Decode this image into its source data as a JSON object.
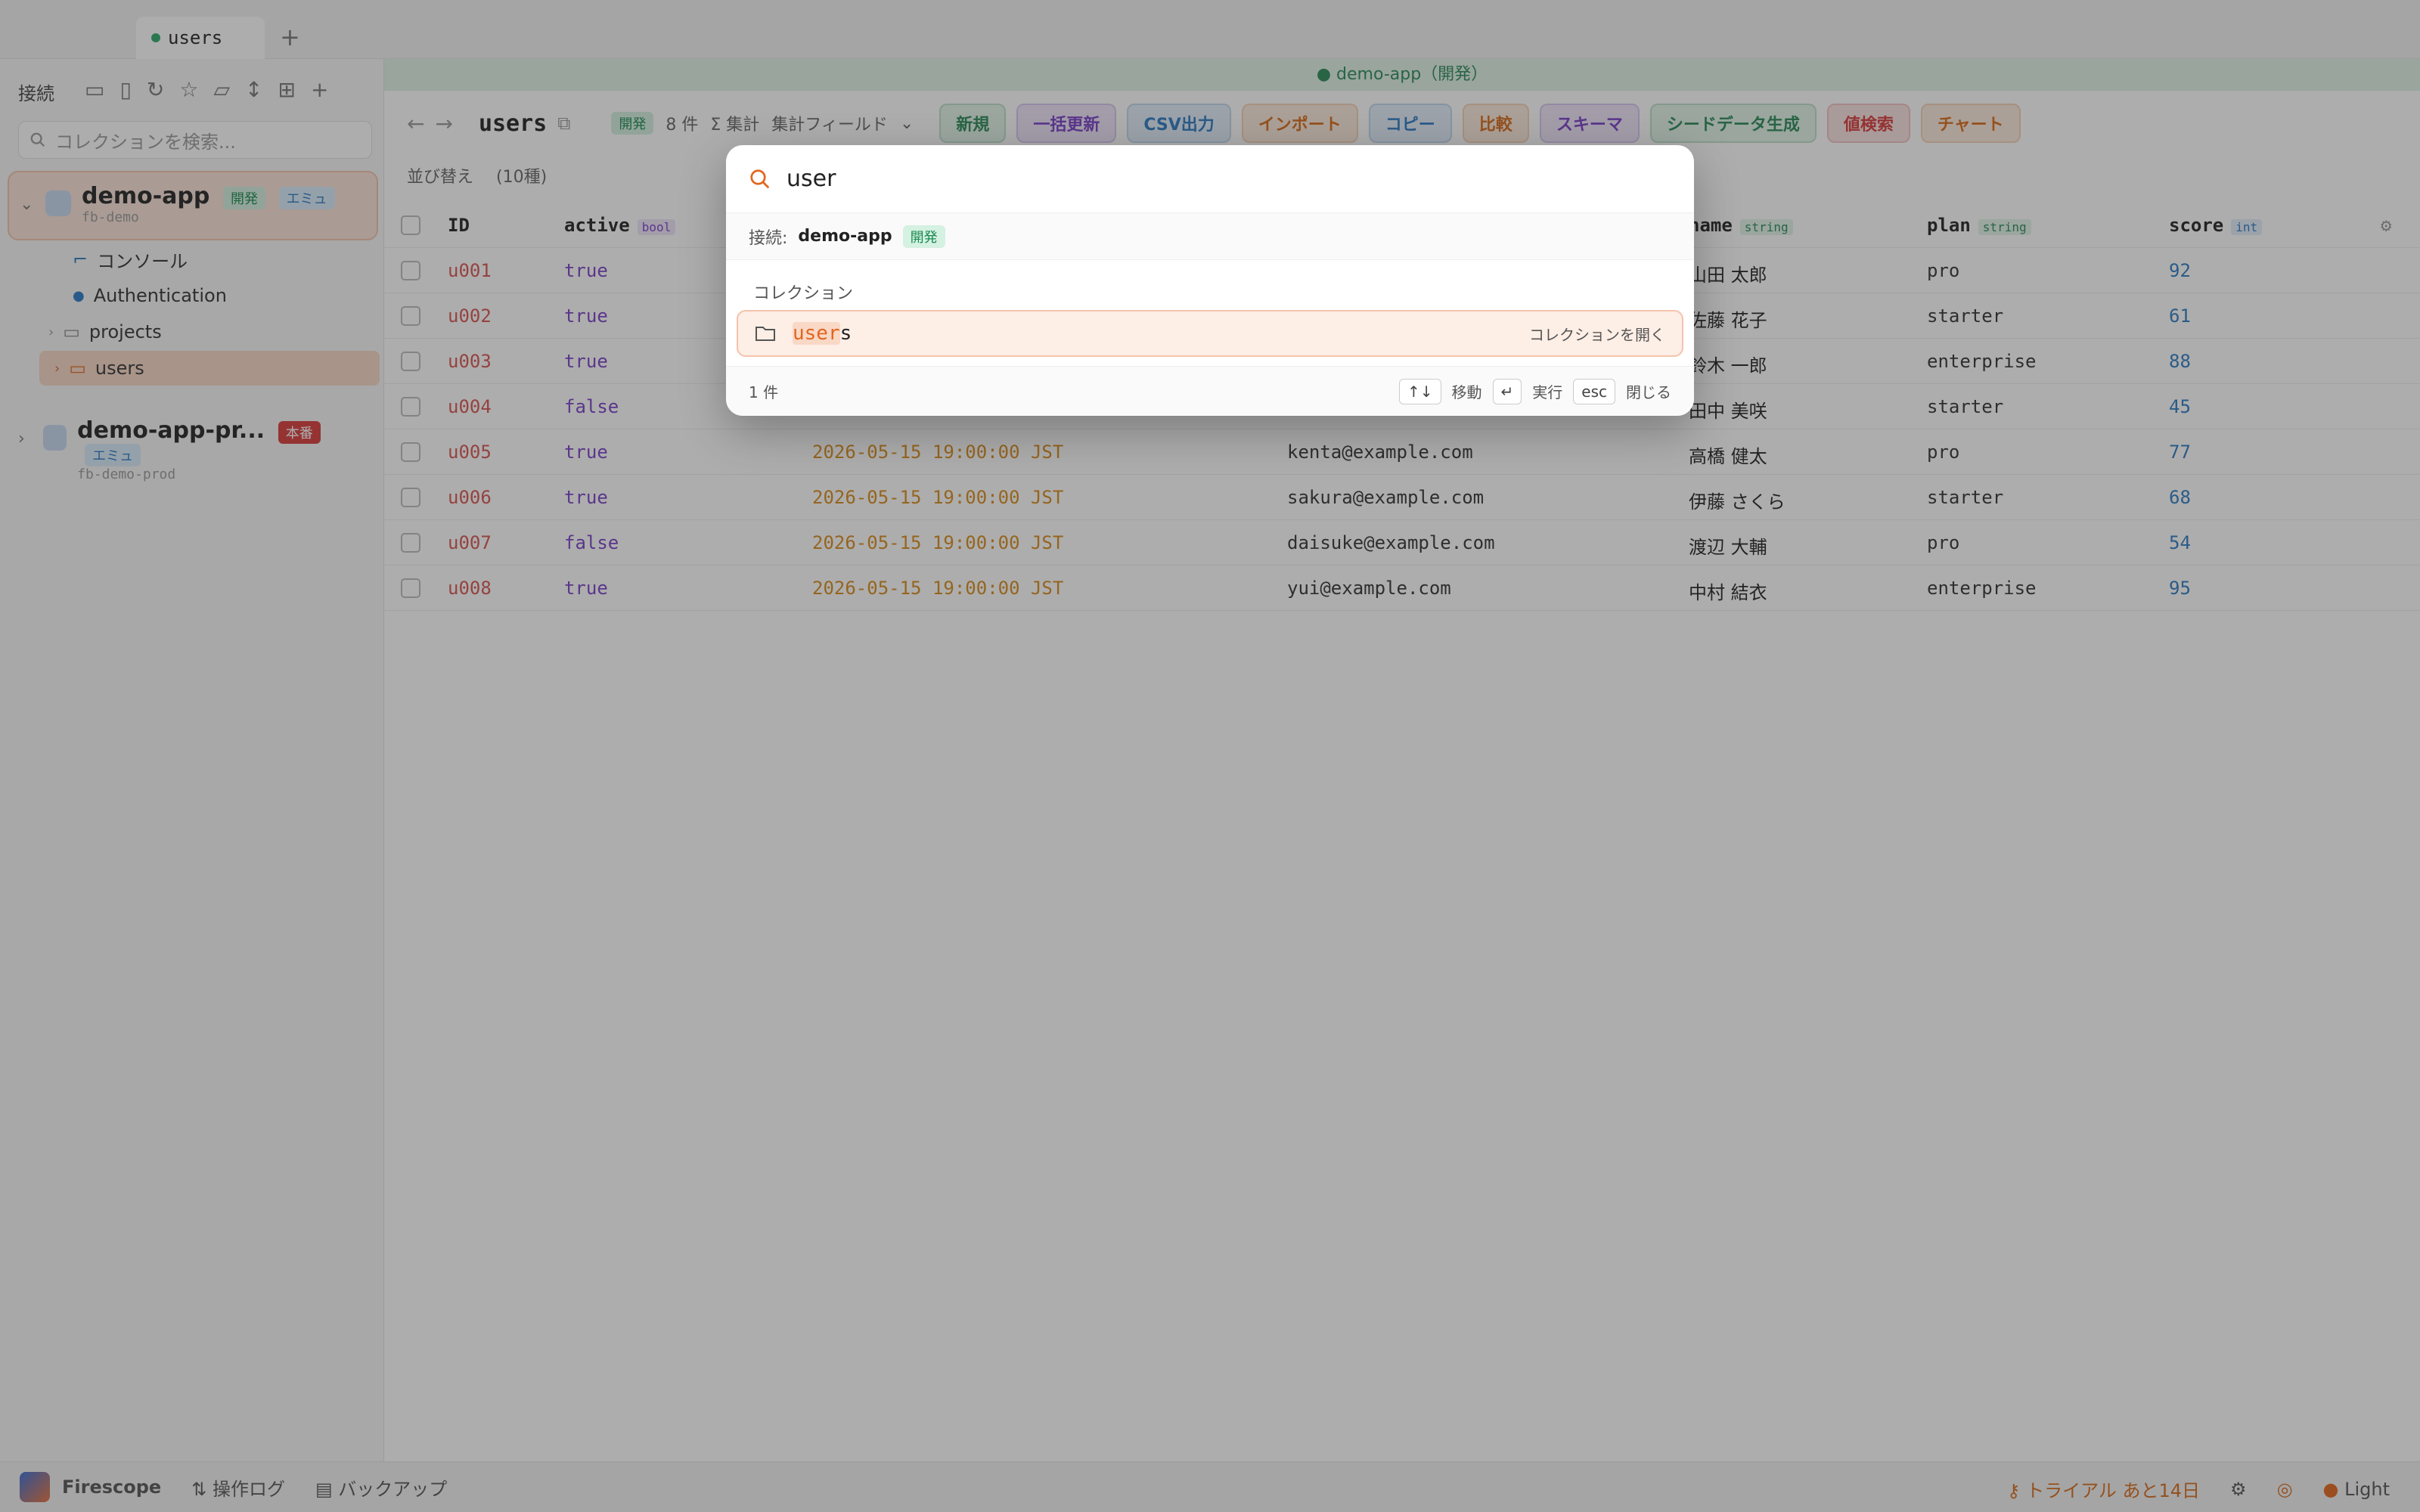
{
  "tabbar": {
    "tab_label": "users",
    "add_label": "+"
  },
  "sidebar": {
    "header": "接続",
    "search_placeholder": "コレクションを検索...",
    "connections": [
      {
        "name": "demo-app",
        "sub": "fb-demo",
        "badges": [
          "開発",
          "エミュ"
        ]
      },
      {
        "name": "demo-app-pr...",
        "sub": "fb-demo-prod",
        "badges": [
          "本番",
          "エミュ"
        ]
      }
    ],
    "tree": [
      {
        "label": "コンソール",
        "icon": "console-icon"
      },
      {
        "label": "Authentication",
        "icon": "person-icon"
      },
      {
        "label": "projects",
        "icon": "folder-icon"
      },
      {
        "label": "users",
        "icon": "folder-icon"
      }
    ]
  },
  "banner": {
    "text": "● demo-app（開発）"
  },
  "toolbar": {
    "title": "users",
    "env_badge": "開発",
    "count": "8 件",
    "aggregate": "Σ 集計",
    "field_select": "集計フィールド",
    "buttons": [
      {
        "label": "新規",
        "color": "#2a8a57",
        "bg": "#e2f4e9"
      },
      {
        "label": "一括更新",
        "color": "#7a3fc9",
        "bg": "#efe6fb"
      },
      {
        "label": "CSV出力",
        "color": "#2d7bc4",
        "bg": "#e3eefb"
      },
      {
        "label": "インポート",
        "color": "#d96b1a",
        "bg": "#fcebdc"
      },
      {
        "label": "コピー",
        "color": "#2d7bc4",
        "bg": "#e3eefb"
      },
      {
        "label": "比較",
        "color": "#d96b1a",
        "bg": "#fcebdc"
      },
      {
        "label": "スキーマ",
        "color": "#7a3fc9",
        "bg": "#efe6fb"
      },
      {
        "label": "シードデータ生成",
        "color": "#2a8a57",
        "bg": "#e2f4e9"
      },
      {
        "label": "値検索",
        "color": "#d93a3a",
        "bg": "#fbe3e3"
      },
      {
        "label": "チャート",
        "color": "#d96b1a",
        "bg": "#fcebdc"
      }
    ]
  },
  "subbar": {
    "sort": "並び替え",
    "count_label": "(10種)"
  },
  "table": {
    "headers": [
      {
        "label": "ID",
        "type": ""
      },
      {
        "label": "active",
        "type": "bool"
      },
      {
        "label": "",
        "type": ""
      },
      {
        "label": "",
        "type": ""
      },
      {
        "label": "name",
        "type": "string"
      },
      {
        "label": "plan",
        "type": "string"
      },
      {
        "label": "score",
        "type": "int"
      }
    ],
    "rows": [
      {
        "id": "u001",
        "active": "true",
        "ts": "",
        "email": "",
        "name": "山田 太郎",
        "plan": "pro",
        "score": "92"
      },
      {
        "id": "u002",
        "active": "true",
        "ts": "",
        "email": "",
        "name": "佐藤 花子",
        "plan": "starter",
        "score": "61"
      },
      {
        "id": "u003",
        "active": "true",
        "ts": "",
        "email": "",
        "name": "鈴木 一郎",
        "plan": "enterprise",
        "score": "88"
      },
      {
        "id": "u004",
        "active": "false",
        "ts": "",
        "email": "",
        "name": "田中 美咲",
        "plan": "starter",
        "score": "45"
      },
      {
        "id": "u005",
        "active": "true",
        "ts": "2026-05-15 19:00:00 JST",
        "email": "kenta@example.com",
        "name": "高橋 健太",
        "plan": "pro",
        "score": "77"
      },
      {
        "id": "u006",
        "active": "true",
        "ts": "2026-05-15 19:00:00 JST",
        "email": "sakura@example.com",
        "name": "伊藤 さくら",
        "plan": "starter",
        "score": "68"
      },
      {
        "id": "u007",
        "active": "false",
        "ts": "2026-05-15 19:00:00 JST",
        "email": "daisuke@example.com",
        "name": "渡辺 大輔",
        "plan": "pro",
        "score": "54"
      },
      {
        "id": "u008",
        "active": "true",
        "ts": "2026-05-15 19:00:00 JST",
        "email": "yui@example.com",
        "name": "中村 結衣",
        "plan": "enterprise",
        "score": "95"
      }
    ]
  },
  "footer": {
    "app_name": "Firescope",
    "log": "操作ログ",
    "backup": "バックアップ",
    "trial": "トライアル あと14日",
    "theme": "Light"
  },
  "palette": {
    "query": "user",
    "conn_label": "接続:",
    "conn_name": "demo-app",
    "conn_badge": "開発",
    "section": "コレクション",
    "item_match": "user",
    "item_rest": "s",
    "item_action": "コレクションを開く",
    "count": "1 件",
    "hint_nav_key": "↑↓",
    "hint_nav": "移動",
    "hint_exec_key": "↵",
    "hint_exec": "実行",
    "hint_close_key": "esc",
    "hint_close": "閉じる"
  }
}
